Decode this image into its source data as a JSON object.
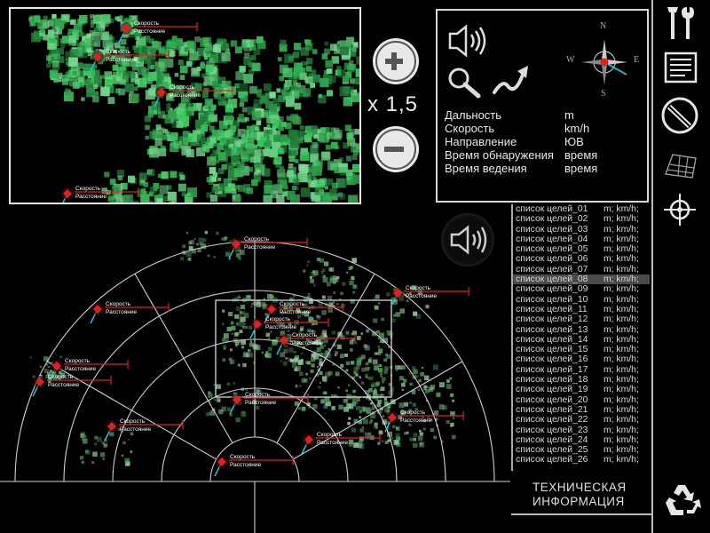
{
  "zoom": {
    "level_label": "x 1,5",
    "zoom_in_icon": "plus-circle-icon",
    "zoom_out_icon": "minus-circle-icon"
  },
  "info_panel": {
    "icons": [
      "speaker-icon",
      "magnifier-icon",
      "trend-arrow-icon",
      "compass-icon"
    ],
    "compass": {
      "n": "N",
      "s": "S",
      "e": "E",
      "w": "W"
    },
    "fields": [
      {
        "label": "Дальность",
        "value": "m"
      },
      {
        "label": "Скорость",
        "value": "km/h"
      },
      {
        "label": "Направление",
        "value": "ЮВ"
      },
      {
        "label": "Время обнаружения",
        "value": "время"
      },
      {
        "label": "Время ведения",
        "value": "время"
      }
    ]
  },
  "target_labels": {
    "speed": "Скорость",
    "distance": "Расстояние"
  },
  "targets_list": {
    "selected_index": 7,
    "items": [
      {
        "name": "список целей_01",
        "value": "m; km/h;"
      },
      {
        "name": "список целей_02",
        "value": "m; km/h;"
      },
      {
        "name": "список целей_03",
        "value": "m; km/h;"
      },
      {
        "name": "список целей_04",
        "value": "m; km/h;"
      },
      {
        "name": "список целей_05",
        "value": "m; km/h;"
      },
      {
        "name": "список целей_06",
        "value": "m; km/h;"
      },
      {
        "name": "список целей_07",
        "value": "m; km/h;"
      },
      {
        "name": "список целей_08",
        "value": "m; km/h;"
      },
      {
        "name": "список целей_09",
        "value": "m; km/h;"
      },
      {
        "name": "список целей_10",
        "value": "m; km/h;"
      },
      {
        "name": "список целей_11",
        "value": "m; km/h;"
      },
      {
        "name": "список целей_12",
        "value": "m; km/h;"
      },
      {
        "name": "список целей_13",
        "value": "m; km/h;"
      },
      {
        "name": "список целей_14",
        "value": "m; km/h;"
      },
      {
        "name": "список целей_15",
        "value": "m; km/h;"
      },
      {
        "name": "список целей_16",
        "value": "m; km/h;"
      },
      {
        "name": "список целей_17",
        "value": "m; km/h;"
      },
      {
        "name": "список целей_18",
        "value": "m; km/h;"
      },
      {
        "name": "список целей_19",
        "value": "m; km/h;"
      },
      {
        "name": "список целей_20",
        "value": "m; km/h;"
      },
      {
        "name": "список целей_21",
        "value": "m; km/h;"
      },
      {
        "name": "список целей_22",
        "value": "m; km/h;"
      },
      {
        "name": "список целей_23",
        "value": "m; km/h;"
      },
      {
        "name": "список целей_24",
        "value": "m; km/h;"
      },
      {
        "name": "список целей_25",
        "value": "m; km/h;"
      },
      {
        "name": "список целей_26",
        "value": "m; km/h;"
      }
    ]
  },
  "technical_info": {
    "line1": "ТЕХНИЧЕСКАЯ",
    "line2": "ИНФОРМАЦИЯ"
  },
  "sidebar": {
    "buttons": [
      "tools-icon",
      "report-icon",
      "no-entry-icon",
      "grid-icon",
      "crosshair-icon"
    ],
    "bottom": "recycle-icon"
  },
  "colors": {
    "accent_red": "#e02020",
    "cyan": "#20c8d8",
    "radar_green": "#3cbf5a",
    "panel_border": "#e8e8e8"
  }
}
